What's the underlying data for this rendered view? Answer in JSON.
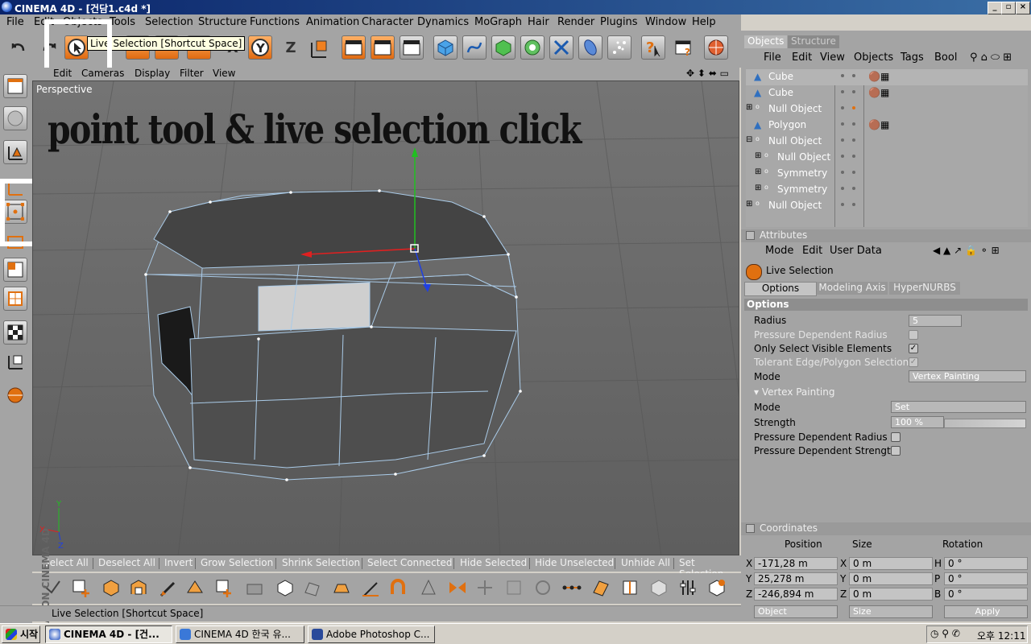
{
  "window": {
    "title": "CINEMA 4D - [건담1.c4d *]",
    "min": "_",
    "max": "▫",
    "close": "×"
  },
  "menubar": [
    "File",
    "Edit",
    "Objects",
    "Tools",
    "Selection",
    "Structure",
    "Functions",
    "Animation",
    "Character",
    "Dynamics",
    "MoGraph",
    "Hair",
    "Render",
    "Plugins",
    "Window",
    "Help"
  ],
  "tooltip": "Live Selection [Shortcut Space]",
  "viewport": {
    "menu": [
      "Edit",
      "Cameras",
      "Display",
      "Filter",
      "View"
    ],
    "label": "Perspective",
    "overlay_text": "point tool & live selection click"
  },
  "selection_bar": [
    "Select All",
    "Deselect All",
    "Invert",
    "Grow Selection",
    "Shrink Selection",
    "Select Connected",
    "Hide Selected",
    "Hide Unselected",
    "Unhide All",
    "Set Selection"
  ],
  "maxon_label": "MAXON CINEMA 4D",
  "status": "Live Selection [Shortcut Space]",
  "objects_panel": {
    "tabs": [
      "Objects",
      "Structure"
    ],
    "menu": [
      "File",
      "Edit",
      "View",
      "Objects",
      "Tags",
      "Bool"
    ],
    "tree": [
      {
        "name": "Cube",
        "type": "poly",
        "expand": false,
        "indent": 0
      },
      {
        "name": "Cube",
        "type": "poly",
        "expand": false,
        "indent": 0
      },
      {
        "name": "Null Object",
        "type": "null",
        "expand": true,
        "indent": 0
      },
      {
        "name": "Polygon",
        "type": "poly",
        "expand": false,
        "indent": 0
      },
      {
        "name": "Null Object",
        "type": "null",
        "expand": true,
        "indent": 0
      },
      {
        "name": "Null Object",
        "type": "null",
        "expand": true,
        "indent": 1
      },
      {
        "name": "Symmetry",
        "type": "null",
        "expand": true,
        "indent": 1
      },
      {
        "name": "Symmetry",
        "type": "null",
        "expand": true,
        "indent": 1
      },
      {
        "name": "Null Object",
        "type": "null",
        "expand": true,
        "indent": 0
      }
    ]
  },
  "attributes": {
    "header": "Attributes",
    "menu": [
      "Mode",
      "Edit",
      "User Data"
    ],
    "tool": "Live Selection",
    "tabs": [
      "Options",
      "Modeling Axis",
      "HyperNURBS"
    ],
    "section": "Options",
    "radius_label": "Radius",
    "radius_value": "5",
    "pressure_radius": "Pressure Dependent Radius",
    "only_visible": "Only Select Visible Elements",
    "tolerant": "Tolerant Edge/Polygon Selection",
    "mode_label": "Mode",
    "mode_value": "Vertex Painting",
    "vp_section": "Vertex Painting",
    "vp_mode_label": "Mode",
    "vp_mode_value": "Set",
    "strength_label": "Strength",
    "strength_value": "100 %",
    "vp_pressure_radius": "Pressure Dependent Radius",
    "vp_pressure_strength": "Pressure Dependent Strength"
  },
  "coordinates": {
    "header": "Coordinates",
    "cols": [
      "Position",
      "Size",
      "Rotation"
    ],
    "rows": [
      {
        "axis": "X",
        "pos": "-171,28 m",
        "saxis": "X",
        "size": "0 m",
        "raxis": "H",
        "rot": "0 °"
      },
      {
        "axis": "Y",
        "pos": "25,278 m",
        "saxis": "Y",
        "size": "0 m",
        "raxis": "P",
        "rot": "0 °"
      },
      {
        "axis": "Z",
        "pos": "-246,894 m",
        "saxis": "Z",
        "size": "0 m",
        "raxis": "B",
        "rot": "0 °"
      }
    ],
    "object_dropdown": "Object",
    "size_dropdown": "Size",
    "apply": "Apply"
  },
  "taskbar": {
    "start": "시작",
    "items": [
      "CINEMA 4D - [건...",
      "CINEMA 4D 한국 유...",
      "Adobe Photoshop C..."
    ],
    "clock": "오후 12:11"
  }
}
